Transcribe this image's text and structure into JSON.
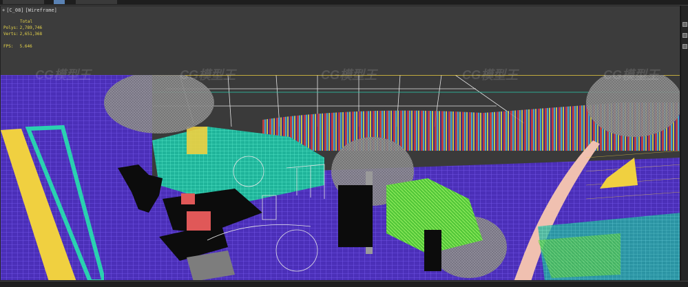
{
  "viewport": {
    "label_plus": "+",
    "label_camera": "[C_08]",
    "label_mode": "[Wireframe]"
  },
  "stats": {
    "total_label": "Total",
    "polys_label": "Polys:",
    "polys_value": "2,789,746",
    "verts_label": "Verts:",
    "verts_value": "2,651,368",
    "fps_label": "FPS:",
    "fps_value": "5.646"
  },
  "watermarks": [
    "CG模型王",
    "CG模型王",
    "CG模型王",
    "CG模型王",
    "CG模型王"
  ],
  "colors": {
    "stats_text": "#e8d64a",
    "wire_purple": "#5a3cc8",
    "wire_teal": "#2ad1b0",
    "wire_yellow": "#f0d040",
    "wire_white": "#e6e6e6",
    "wire_green": "#7be04a",
    "wire_pink": "#f0c0b0"
  }
}
